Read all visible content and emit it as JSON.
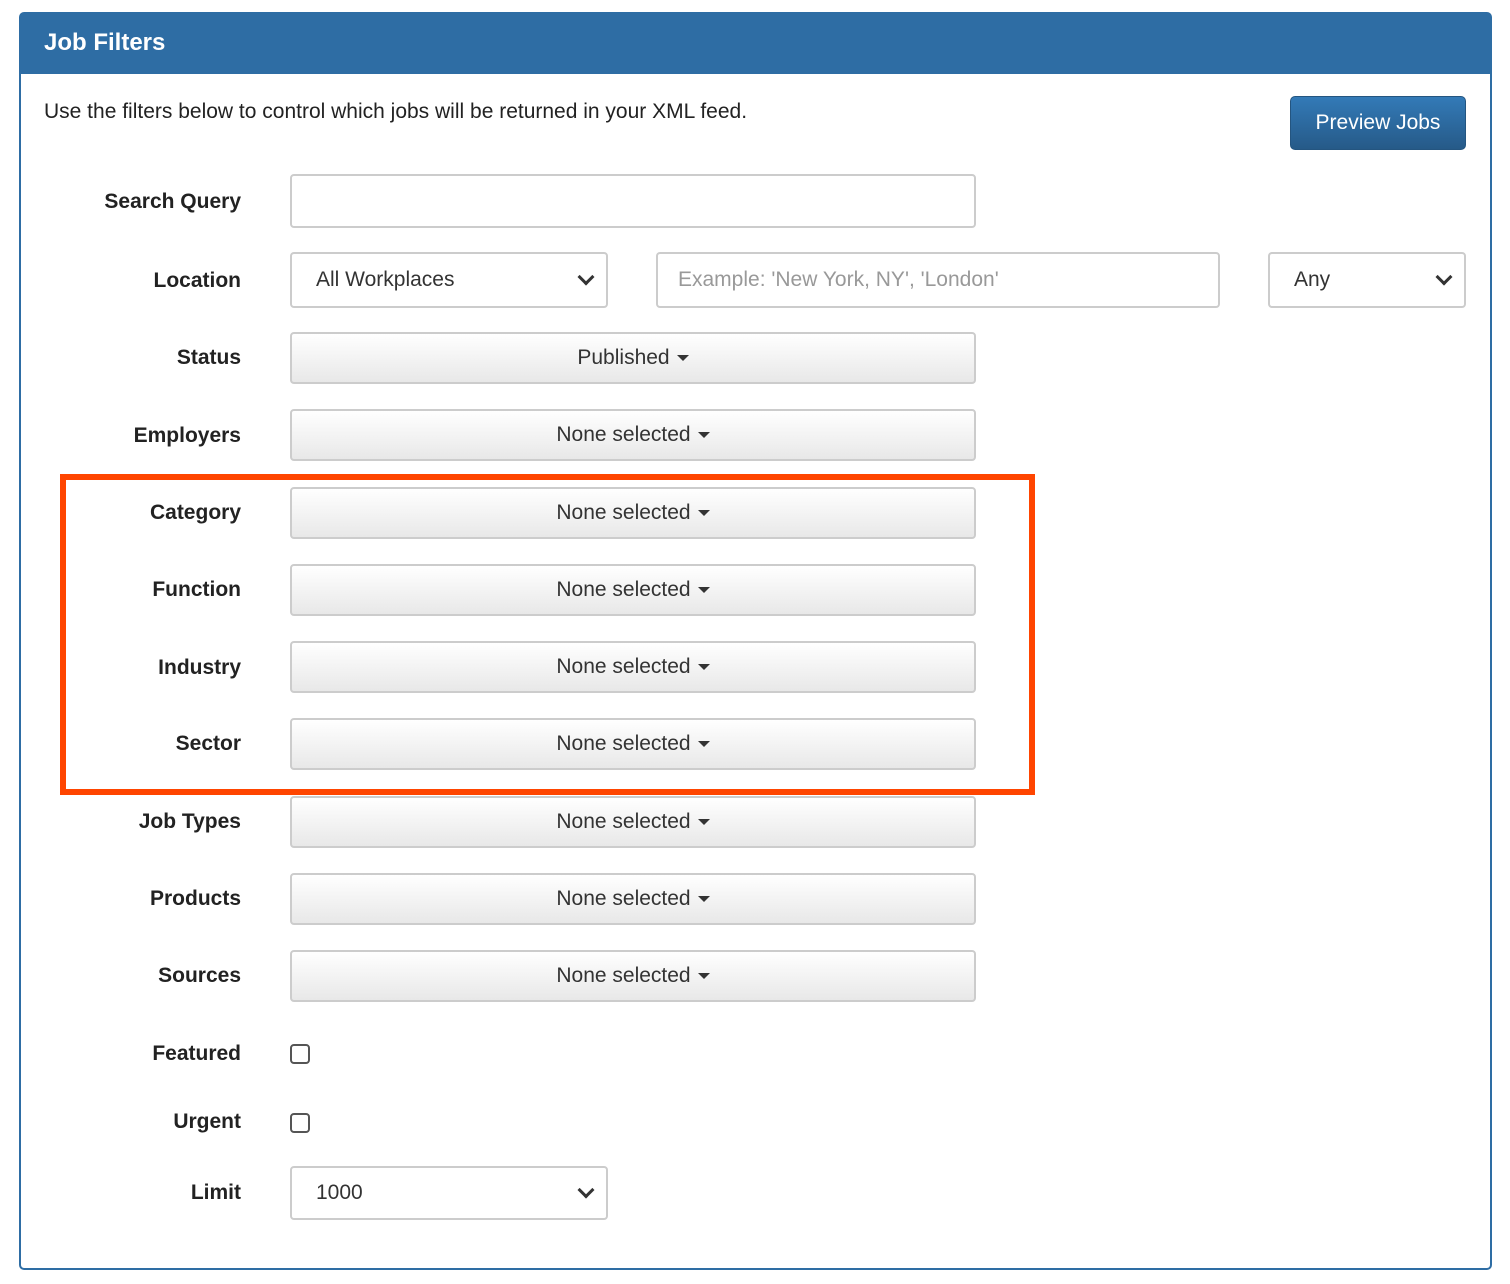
{
  "panel": {
    "title": "Job Filters",
    "intro": "Use the filters below to control which jobs will be returned in your XML feed.",
    "preview_label": "Preview Jobs"
  },
  "search": {
    "label": "Search Query",
    "value": "",
    "placeholder": ""
  },
  "location": {
    "label": "Location",
    "workplace": "All Workplaces",
    "placeholder": "Example: 'New York, NY', 'London'",
    "radius": "Any"
  },
  "status": {
    "label": "Status",
    "value": "Published"
  },
  "multiselects": [
    {
      "label": "Employers",
      "value": "None selected"
    },
    {
      "label": "Category",
      "value": "None selected"
    },
    {
      "label": "Function",
      "value": "None selected"
    },
    {
      "label": "Industry",
      "value": "None selected"
    },
    {
      "label": "Sector",
      "value": "None selected"
    },
    {
      "label": "Job Types",
      "value": "None selected"
    },
    {
      "label": "Products",
      "value": "None selected"
    },
    {
      "label": "Sources",
      "value": "None selected"
    }
  ],
  "featured": {
    "label": "Featured",
    "checked": false
  },
  "urgent": {
    "label": "Urgent",
    "checked": false
  },
  "limit": {
    "label": "Limit",
    "value": "1000"
  },
  "highlight_color": "#ff4500"
}
